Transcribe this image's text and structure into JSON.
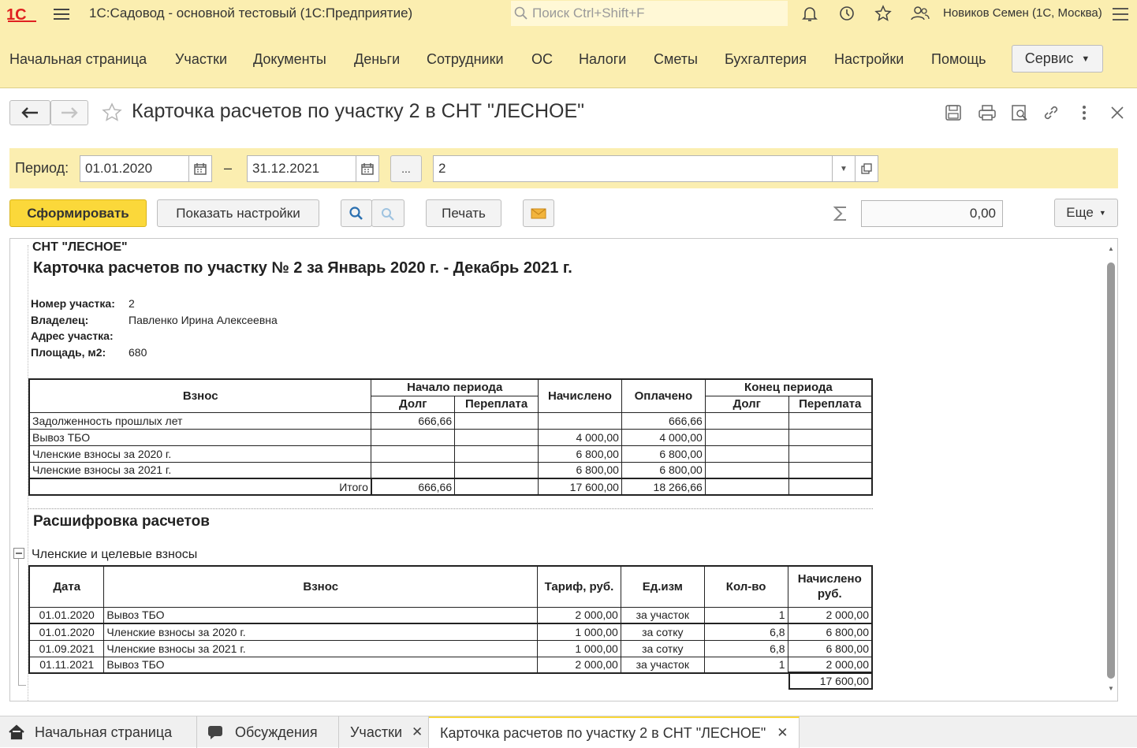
{
  "app": {
    "title": "1С:Садовод - основной тестовый  (1С:Предприятие)",
    "search_placeholder": "Поиск Ctrl+Shift+F",
    "user": "Новиков Семен (1С, Москва)"
  },
  "menu": {
    "items": [
      "Начальная страница",
      "Участки",
      "Документы",
      "Деньги",
      "Сотрудники",
      "ОС",
      "Налоги",
      "Сметы",
      "Бухгалтерия",
      "Настройки",
      "Помощь"
    ],
    "service": "Сервис"
  },
  "form": {
    "title": "Карточка расчетов по участку 2 в СНТ \"ЛЕСНОЕ\"",
    "period_label": "Период:",
    "date_from": "01.01.2020",
    "dash": "–",
    "date_to": "31.12.2021",
    "ellipsis": "...",
    "plot": "2",
    "generate_btn": "Сформировать",
    "settings_btn": "Показать настройки",
    "print_btn": "Печать",
    "sum_value": "0,00",
    "more_btn": "Еще"
  },
  "report": {
    "org": "СНТ \"ЛЕСНОЕ\"",
    "heading": "Карточка расчетов по участку № 2  за Январь 2020 г. - Декабрь 2021 г.",
    "info": [
      {
        "label": "Номер участка:",
        "value": "2"
      },
      {
        "label": "Владелец:",
        "value": "Павленко Ирина Алексеевна"
      },
      {
        "label": "Адрес участка:",
        "value": ""
      },
      {
        "label": "Площадь, м2:",
        "value": "680"
      }
    ],
    "summary": {
      "h_fee": "Взнос",
      "h_start": "Начало периода",
      "h_accrued": "Начислено",
      "h_paid": "Оплачено",
      "h_end": "Конец периода",
      "h_debt": "Долг",
      "h_over": "Переплата",
      "rows": [
        [
          "Задолженность прошлых лет",
          "666,66",
          "",
          "",
          "666,66",
          "",
          ""
        ],
        [
          "Вывоз ТБО",
          "",
          "",
          "4 000,00",
          "4 000,00",
          "",
          ""
        ],
        [
          "Членские взносы за 2020 г.",
          "",
          "",
          "6 800,00",
          "6 800,00",
          "",
          ""
        ],
        [
          "Членские взносы за 2021 г.",
          "",
          "",
          "6 800,00",
          "6 800,00",
          "",
          ""
        ]
      ],
      "total": [
        "Итого",
        "666,66",
        "",
        "17 600,00",
        "18 266,66",
        "",
        ""
      ]
    },
    "detail_title": "Расшифровка расчетов",
    "group_name": "Членские и целевые взносы",
    "detail": {
      "h_date": "Дата",
      "h_fee": "Взнос",
      "h_tariff": "Тариф, руб.",
      "h_unit": "Ед.изм",
      "h_qty": "Кол-во",
      "h_accrued": "Начислено руб.",
      "rows": [
        [
          "01.01.2020",
          "Вывоз ТБО",
          "2 000,00",
          "за участок",
          "1",
          "2 000,00"
        ],
        [
          "01.01.2020",
          "Членские взносы за 2020 г.",
          "1 000,00",
          "за сотку",
          "6,8",
          "6 800,00"
        ],
        [
          "01.09.2021",
          "Членские взносы за 2021 г.",
          "1 000,00",
          "за сотку",
          "6,8",
          "6 800,00"
        ],
        [
          "01.11.2021",
          "Вывоз ТБО",
          "2 000,00",
          "за участок",
          "1",
          "2 000,00"
        ]
      ],
      "total": "17 600,00"
    }
  },
  "tabs": [
    "Начальная страница",
    "Обсуждения",
    "Участки",
    "Карточка расчетов по участку 2 в СНТ \"ЛЕСНОЕ\""
  ]
}
